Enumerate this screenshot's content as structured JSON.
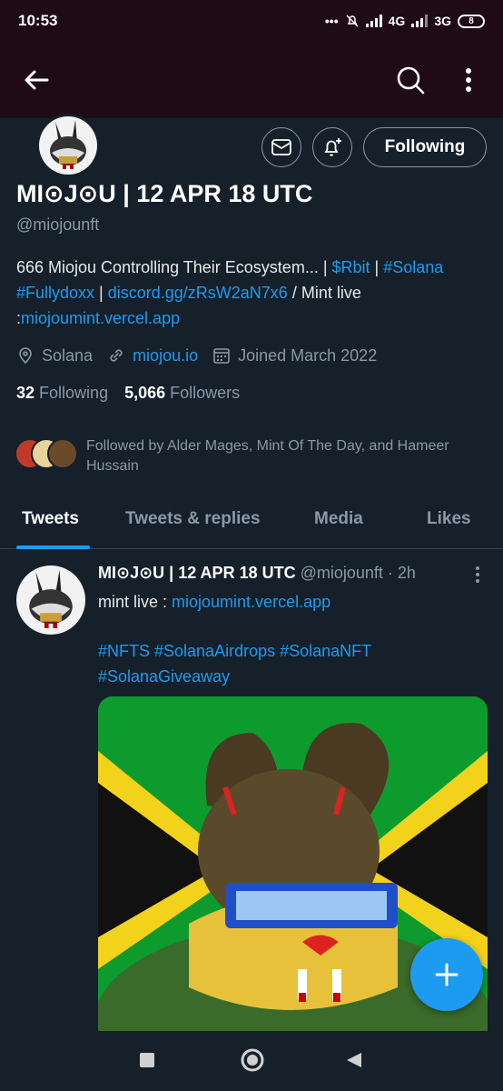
{
  "status_bar": {
    "time": "10:53",
    "dots": "•••",
    "network1": "4G",
    "network2": "3G",
    "battery": "8"
  },
  "app_bar": {
    "back_icon": "arrow-left-icon",
    "search_icon": "search-icon",
    "more_icon": "more-vertical-icon"
  },
  "profile": {
    "display_name": "MI⊙J⊙U | 12 APR 18 UTC",
    "handle": "@miojounft",
    "bio": {
      "text1": "666 Miojou Controlling Their Ecosystem... | ",
      "tag1": "$Rbit",
      "sep1": " | ",
      "tag2": "#Solana",
      "sp1": " ",
      "tag3": "#Fullydoxx",
      "sep2": " | ",
      "link1": "discord.gg/zRsW2aN7x6",
      "text2": "  / Mint live :",
      "link2": "miojoumint.vercel.app"
    },
    "location": "Solana",
    "website": "miojou.io",
    "joined": "Joined March 2022",
    "following_count": "32",
    "following_label": "Following",
    "followers_count": "5,066",
    "followers_label": "Followers",
    "followed_by": "Followed by Alder Mages, Mint Of The Day, and Hameer Hussain",
    "follow_button": "Following"
  },
  "tabs": [
    {
      "label": "Tweets",
      "active": true
    },
    {
      "label": "Tweets & replies",
      "active": false
    },
    {
      "label": "Media",
      "active": false
    },
    {
      "label": "Likes",
      "active": false
    }
  ],
  "tweet": {
    "name": "MI⊙J⊙U | 12 APR 18 UTC",
    "handle_time": "@miojounft · 2h",
    "text_prefix": "mint live : ",
    "text_link": "miojoumint.vercel.app",
    "hashtags": "#NFTS #SolanaAirdrops #SolanaNFT #SolanaGiveaway"
  },
  "colors": {
    "background": "#15202b",
    "accent": "#1d9bf0",
    "secondary_text": "#8b98a5",
    "header_bar": "#1e0b14"
  }
}
